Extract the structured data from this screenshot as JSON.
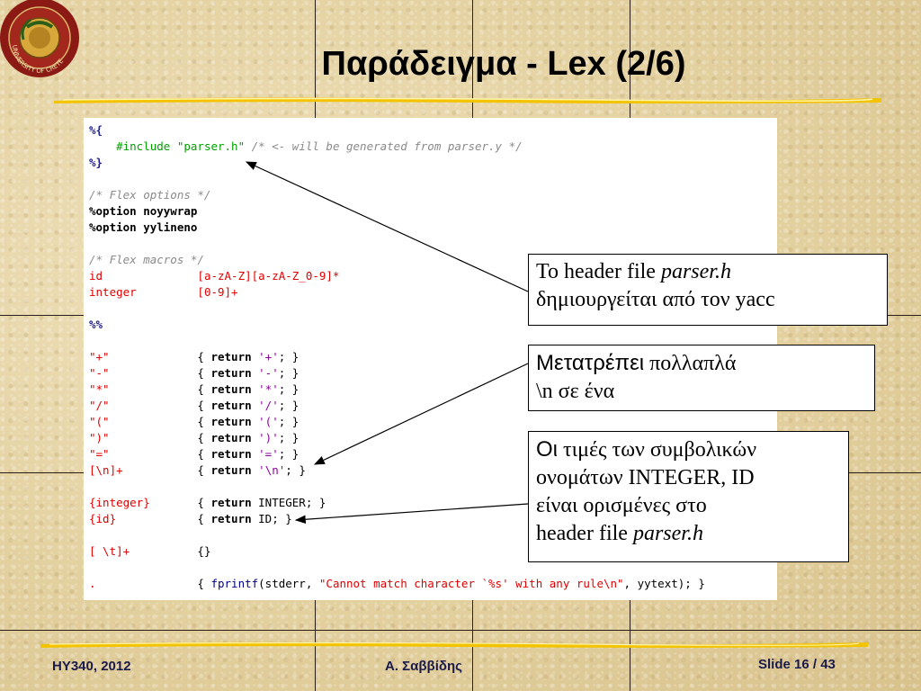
{
  "slide": {
    "title": "Παράδειγμα - Lex (2/6)",
    "logo_label": "UNIVERSITY OF CRETE",
    "code_lines": [
      [
        {
          "t": "%{",
          "c": "pp"
        }
      ],
      [
        {
          "t": "    ",
          "c": ""
        },
        {
          "t": "#include \"parser.h\"",
          "c": "inc"
        },
        {
          "t": " /* <- will be generated from parser.y */",
          "c": "cmt"
        }
      ],
      [
        {
          "t": "%}",
          "c": "pp"
        }
      ],
      [],
      [
        {
          "t": "/* Flex options */",
          "c": "cmt"
        }
      ],
      [
        {
          "t": "%option noyywrap",
          "c": "opt"
        }
      ],
      [
        {
          "t": "%option yylineno",
          "c": "opt"
        }
      ],
      [],
      [
        {
          "t": "/* Flex macros */",
          "c": "cmt"
        }
      ],
      [
        {
          "t": "id",
          "c": "red"
        },
        {
          "t": "              ",
          "c": ""
        },
        {
          "t": "[a-zA-Z][a-zA-Z_0-9]*",
          "c": "red"
        }
      ],
      [
        {
          "t": "integer",
          "c": "red"
        },
        {
          "t": "         ",
          "c": ""
        },
        {
          "t": "[0-9]+",
          "c": "red"
        }
      ],
      [],
      [
        {
          "t": "%%",
          "c": "pp"
        }
      ],
      [],
      [
        {
          "t": "\"+\"",
          "c": "red"
        },
        {
          "t": "             { ",
          "c": ""
        },
        {
          "t": "return",
          "c": "kw"
        },
        {
          "t": " ",
          "c": ""
        },
        {
          "t": "'+'",
          "c": "purple"
        },
        {
          "t": "; }",
          "c": ""
        }
      ],
      [
        {
          "t": "\"-\"",
          "c": "red"
        },
        {
          "t": "             { ",
          "c": ""
        },
        {
          "t": "return",
          "c": "kw"
        },
        {
          "t": " ",
          "c": ""
        },
        {
          "t": "'-'",
          "c": "purple"
        },
        {
          "t": "; }",
          "c": ""
        }
      ],
      [
        {
          "t": "\"*\"",
          "c": "red"
        },
        {
          "t": "             { ",
          "c": ""
        },
        {
          "t": "return",
          "c": "kw"
        },
        {
          "t": " ",
          "c": ""
        },
        {
          "t": "'*'",
          "c": "purple"
        },
        {
          "t": "; }",
          "c": ""
        }
      ],
      [
        {
          "t": "\"/\"",
          "c": "red"
        },
        {
          "t": "             { ",
          "c": ""
        },
        {
          "t": "return",
          "c": "kw"
        },
        {
          "t": " ",
          "c": ""
        },
        {
          "t": "'/'",
          "c": "purple"
        },
        {
          "t": "; }",
          "c": ""
        }
      ],
      [
        {
          "t": "\"(\"",
          "c": "red"
        },
        {
          "t": "             { ",
          "c": ""
        },
        {
          "t": "return",
          "c": "kw"
        },
        {
          "t": " ",
          "c": ""
        },
        {
          "t": "'('",
          "c": "purple"
        },
        {
          "t": "; }",
          "c": ""
        }
      ],
      [
        {
          "t": "\")\"",
          "c": "red"
        },
        {
          "t": "             { ",
          "c": ""
        },
        {
          "t": "return",
          "c": "kw"
        },
        {
          "t": " ",
          "c": ""
        },
        {
          "t": "')'",
          "c": "purple"
        },
        {
          "t": "; }",
          "c": ""
        }
      ],
      [
        {
          "t": "\"=\"",
          "c": "red"
        },
        {
          "t": "             { ",
          "c": ""
        },
        {
          "t": "return",
          "c": "kw"
        },
        {
          "t": " ",
          "c": ""
        },
        {
          "t": "'='",
          "c": "purple"
        },
        {
          "t": "; }",
          "c": ""
        }
      ],
      [
        {
          "t": "[\\n]+",
          "c": "red"
        },
        {
          "t": "           { ",
          "c": ""
        },
        {
          "t": "return",
          "c": "kw"
        },
        {
          "t": " ",
          "c": ""
        },
        {
          "t": "'\\n'",
          "c": "purple"
        },
        {
          "t": "; }",
          "c": ""
        }
      ],
      [],
      [
        {
          "t": "{integer}",
          "c": "red"
        },
        {
          "t": "       { ",
          "c": ""
        },
        {
          "t": "return",
          "c": "kw"
        },
        {
          "t": " INTEGER; }",
          "c": ""
        }
      ],
      [
        {
          "t": "{id}",
          "c": "red"
        },
        {
          "t": "            { ",
          "c": ""
        },
        {
          "t": "return",
          "c": "kw"
        },
        {
          "t": " ID; }",
          "c": ""
        }
      ],
      [],
      [
        {
          "t": "[ \\t]+",
          "c": "red"
        },
        {
          "t": "          {}",
          "c": ""
        }
      ],
      [],
      [
        {
          "t": ".",
          "c": "red"
        },
        {
          "t": "               { ",
          "c": ""
        },
        {
          "t": "fprintf",
          "c": "fn"
        },
        {
          "t": "(stderr, ",
          "c": ""
        },
        {
          "t": "\"Cannot match character `%s' with any rule\\n\"",
          "c": "red"
        },
        {
          "t": ", yytext); }",
          "c": ""
        }
      ]
    ],
    "callouts": [
      {
        "parts": [
          {
            "t": "Το header file ",
            "c": ""
          },
          {
            "t": "parser.h",
            "c": "it"
          },
          {
            "t": "\nδημιουργείται από τον yacc",
            "c": ""
          }
        ]
      },
      {
        "parts": [
          {
            "t": "Μετατρέπει",
            "c": "sans"
          },
          {
            "t": " πολλαπλά\n\\n σε ένα",
            "c": ""
          }
        ]
      },
      {
        "parts": [
          {
            "t": "Οι",
            "c": "sans"
          },
          {
            "t": " τιμές των συμβολικών\nονομάτων INTEGER, ID\nείναι ορισμένες στο\nheader file ",
            "c": ""
          },
          {
            "t": "parser.h",
            "c": "it"
          }
        ]
      }
    ],
    "footer": {
      "course": "HY340, 2012",
      "author": "Α. Σαββίδης",
      "slide_number": "Slide 16 / 43"
    }
  },
  "colors": {
    "background": "#e8d7ab",
    "gold_rule": "#f2c400",
    "code_red": "#e00000",
    "code_green": "#00a000",
    "code_comment": "#8a8a8a",
    "footer_text": "#1a1a4a"
  }
}
